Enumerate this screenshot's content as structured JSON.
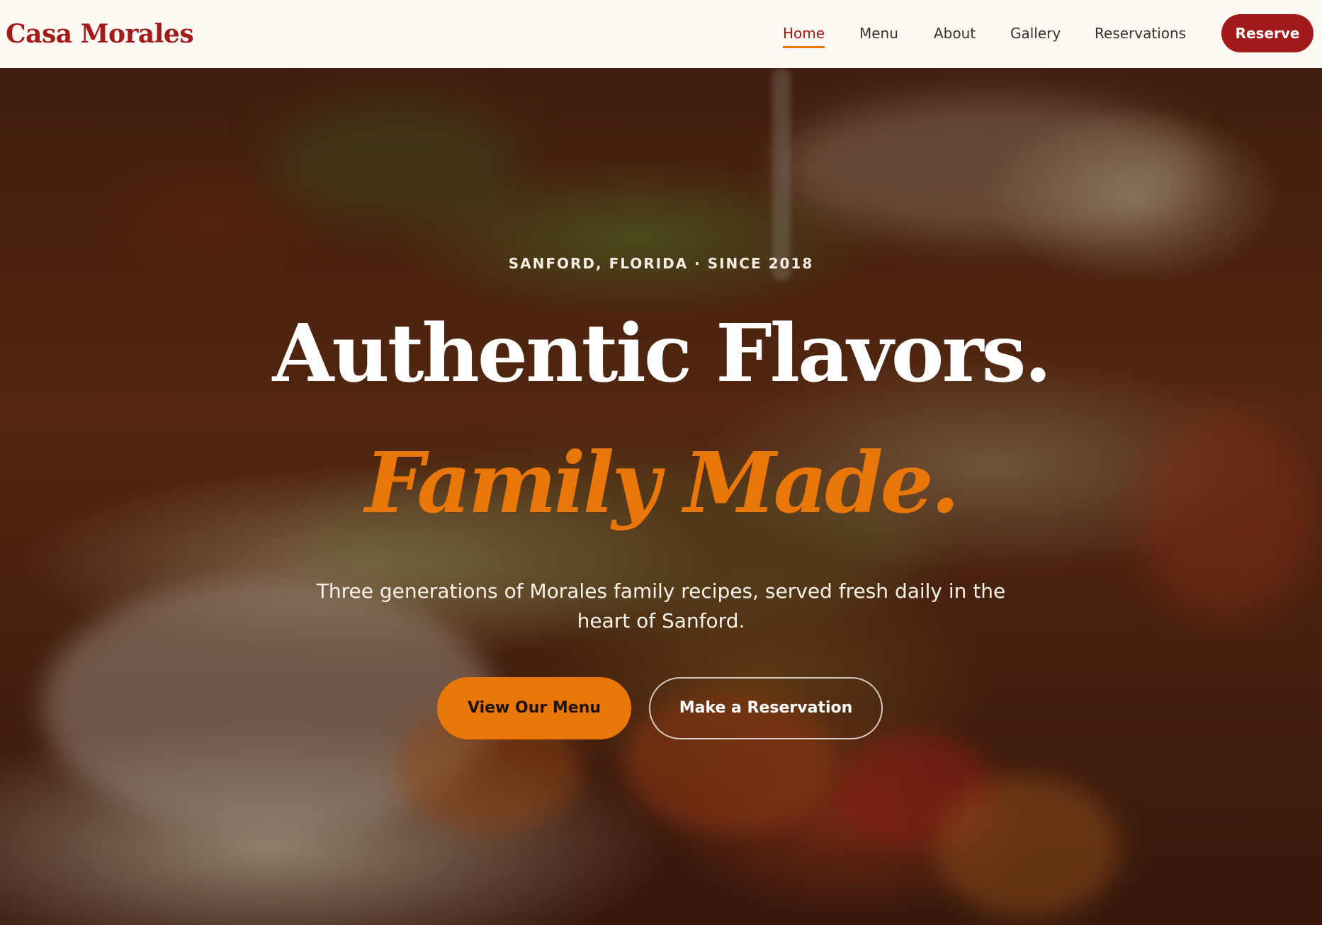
{
  "header": {
    "brand": "Casa Morales",
    "nav": [
      {
        "label": "Home",
        "active": true
      },
      {
        "label": "Menu",
        "active": false
      },
      {
        "label": "About",
        "active": false
      },
      {
        "label": "Gallery",
        "active": false
      },
      {
        "label": "Reservations",
        "active": false
      }
    ],
    "cta_label": "Reserve"
  },
  "hero": {
    "eyebrow": "SANFORD, FLORIDA · SINCE 2018",
    "headline": "Authentic Flavors.",
    "headline_accent": "Family Made.",
    "subtext": "Three generations of Morales family recipes, served fresh daily in the heart of Sanford.",
    "primary_button": "View Our Menu",
    "secondary_button": "Make a Reservation"
  },
  "colors": {
    "brand": "#a31a1a",
    "accent": "#e97608",
    "header_bg": "#fdf8f1"
  }
}
